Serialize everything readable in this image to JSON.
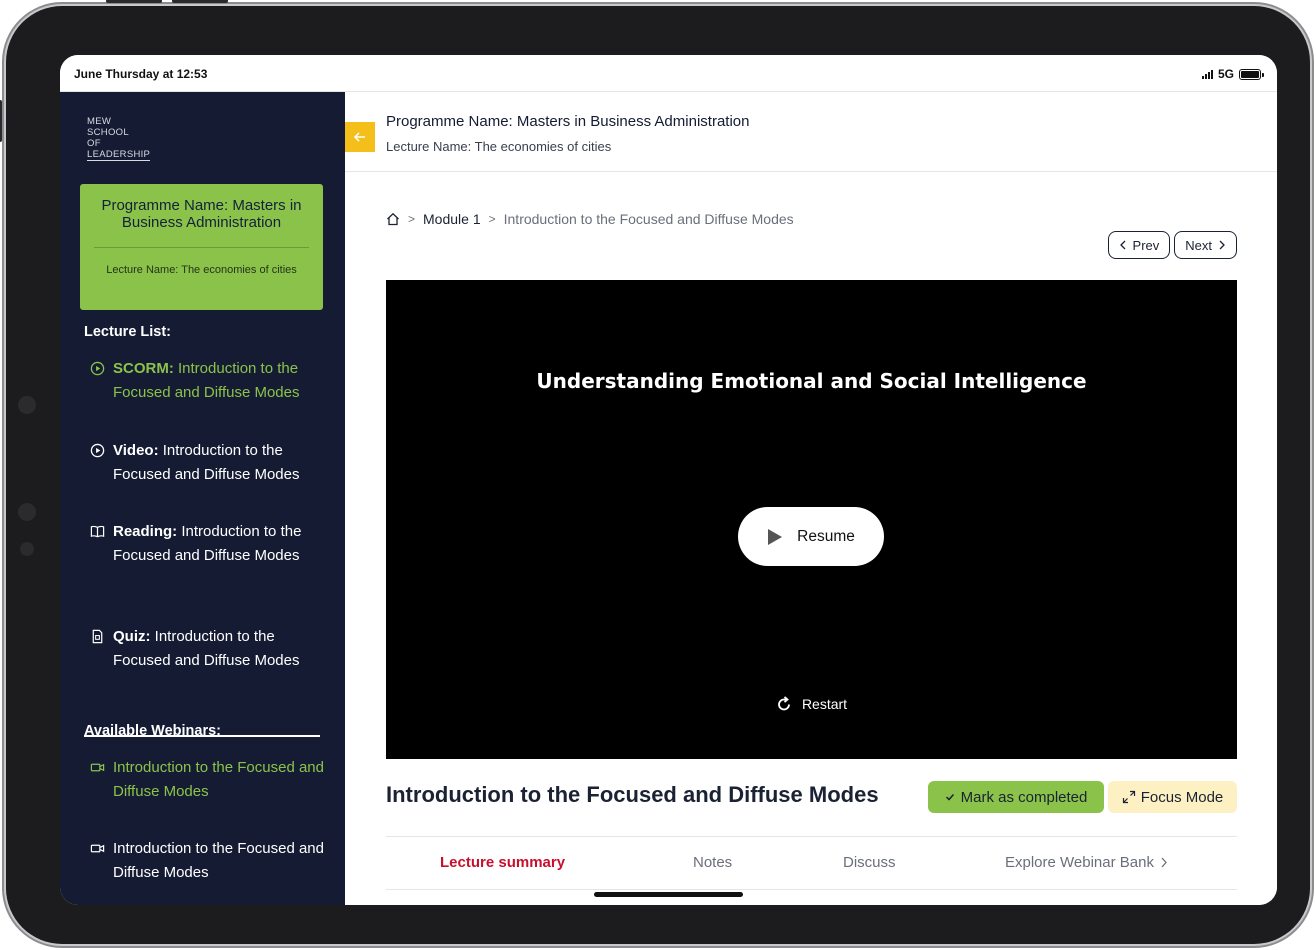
{
  "status_bar": {
    "time": "June Thursday at 12:53",
    "network": "5G"
  },
  "sidebar": {
    "logo_lines": [
      "MEW",
      "SCHOOL",
      "OF",
      "LEADERSHIP"
    ],
    "program_card": {
      "title": "Programme Name: Masters in Business Administration",
      "lecture": "Lecture Name: The economies of cities"
    },
    "lecture_list_title": "Lecture List:",
    "lectures": [
      {
        "kind": "SCORM:",
        "title": " Introduction to the Focused and Diffuse Modes",
        "icon": "play-circle-icon",
        "active": true
      },
      {
        "kind": "Video:",
        "title": " Introduction to the Focused and Diffuse Modes",
        "icon": "play-circle-icon",
        "active": false
      },
      {
        "kind": "Reading:",
        "title": " Introduction to the Focused and Diffuse Modes",
        "icon": "book-icon",
        "active": false
      },
      {
        "kind": "Quiz:",
        "title": " Introduction to the Focused and Diffuse Modes",
        "icon": "quiz-document-icon",
        "active": false
      }
    ],
    "webinars_title": "Available Webinars:",
    "webinars": [
      {
        "title": "Introduction to the Focused and Diffuse Modes",
        "icon": "video-camera-icon",
        "active": true
      },
      {
        "title": "Introduction to the Focused and Diffuse Modes",
        "icon": "video-camera-icon",
        "active": false
      }
    ]
  },
  "header": {
    "program": "Programme Name: Masters in Business Administration",
    "lecture": "Lecture Name: The economies of cities",
    "back_icon": "arrow-left-icon"
  },
  "breadcrumb": {
    "home_icon": "home-icon",
    "separator": ">",
    "module": "Module 1",
    "current": "Introduction to the Focused and Diffuse Modes"
  },
  "pager": {
    "prev": "Prev",
    "next": "Next"
  },
  "video": {
    "title": "Understanding Emotional and Social Intelligence",
    "resume": "Resume",
    "restart": "Restart"
  },
  "lecture": {
    "heading": "Introduction to the Focused and Diffuse Modes",
    "mark_completed": "Mark as completed",
    "focus_mode": "Focus Mode"
  },
  "tabs": [
    {
      "label": "Lecture summary",
      "active": true
    },
    {
      "label": "Notes",
      "active": false
    },
    {
      "label": "Discuss",
      "active": false
    },
    {
      "label": "Explore Webinar Bank",
      "active": false
    }
  ],
  "colors": {
    "sidebar_bg": "#141b33",
    "accent_green": "#8bc34a",
    "back_button": "#f5bf1b",
    "active_tab": "#c8102e",
    "focus_button": "#fdf0c3"
  }
}
